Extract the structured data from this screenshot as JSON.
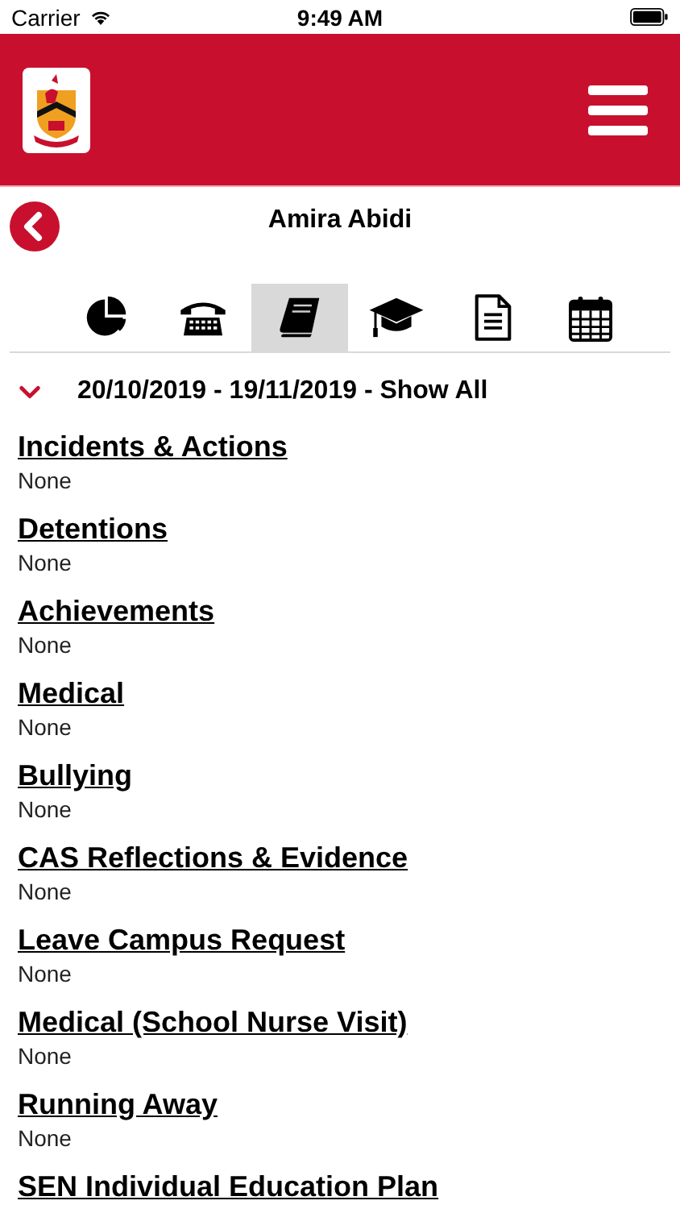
{
  "status_bar": {
    "carrier": "Carrier",
    "time": "9:49 AM"
  },
  "header": {
    "student_name": "Amira Abidi"
  },
  "tabs": [
    {
      "kind": "chart",
      "selected": false
    },
    {
      "kind": "phone",
      "selected": false
    },
    {
      "kind": "book",
      "selected": true
    },
    {
      "kind": "cap",
      "selected": false
    },
    {
      "kind": "document",
      "selected": false
    },
    {
      "kind": "calendar",
      "selected": false
    }
  ],
  "date_filter": {
    "label": "20/10/2019 - 19/11/2019 - Show All",
    "expanded": true
  },
  "sections": [
    {
      "title": "Incidents & Actions",
      "value": "None"
    },
    {
      "title": "Detentions",
      "value": "None"
    },
    {
      "title": "Achievements",
      "value": "None"
    },
    {
      "title": "Medical",
      "value": "None"
    },
    {
      "title": "Bullying",
      "value": "None"
    },
    {
      "title": "CAS Reflections & Evidence",
      "value": "None"
    },
    {
      "title": "Leave Campus Request",
      "value": "None"
    },
    {
      "title": "Medical (School Nurse Visit)",
      "value": "None"
    },
    {
      "title": "Running Away",
      "value": "None"
    },
    {
      "title": "SEN Individual Education Plan"
    }
  ]
}
